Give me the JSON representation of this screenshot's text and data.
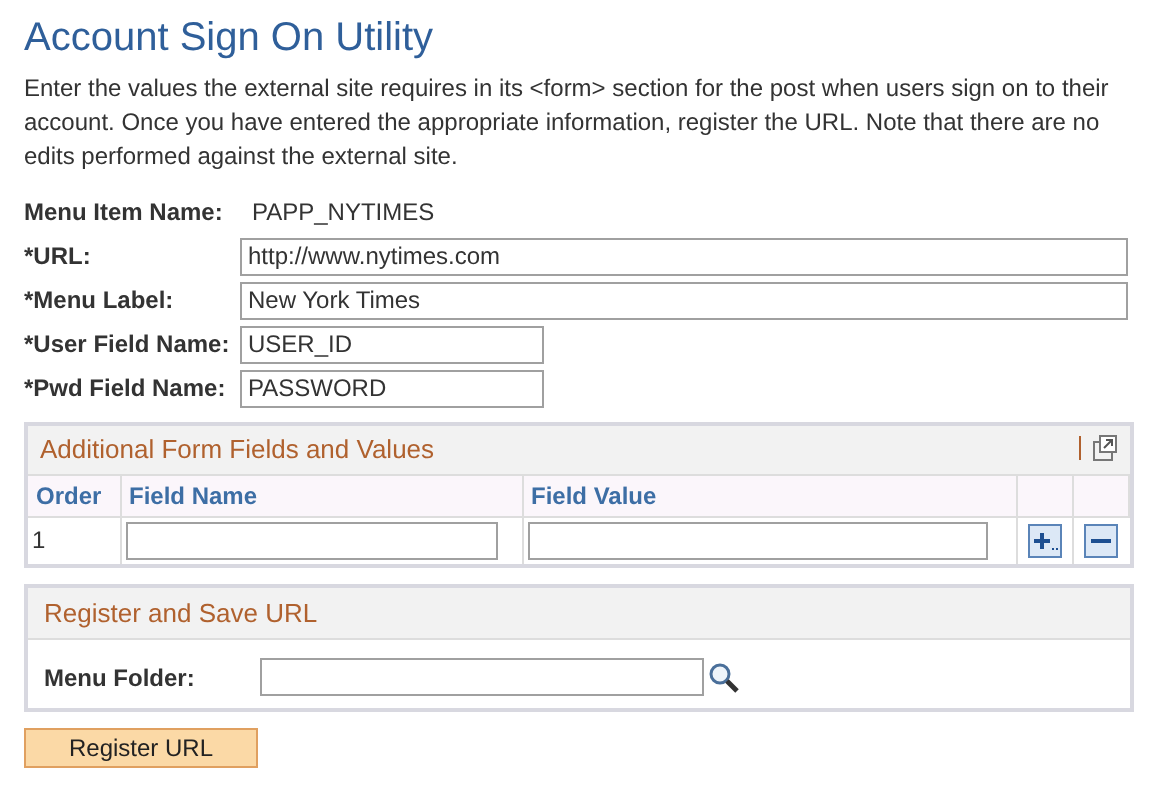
{
  "title": "Account Sign On Utility",
  "description": "Enter the values the external site requires in its <form> section for the post when users sign on to their account. Once you have entered the appropriate information, register the URL. Note that there are no edits performed against the external site.",
  "fields": [
    {
      "label": "Menu Item Name:",
      "value": "PAPP_NYTIMES",
      "kind": "static"
    },
    {
      "label": "*URL:",
      "value": "http://www.nytimes.com",
      "kind": "long"
    },
    {
      "label": "*Menu Label:",
      "value": "New York Times",
      "kind": "long"
    },
    {
      "label": "*User Field Name:",
      "value": "USER_ID",
      "kind": "short"
    },
    {
      "label": "*Pwd Field Name:",
      "value": "PASSWORD",
      "kind": "short"
    }
  ],
  "grid": {
    "title": "Additional Form Fields and Values",
    "columns": [
      "Order",
      "Field Name",
      "Field Value"
    ],
    "rows": [
      {
        "order": "1"
      }
    ]
  },
  "register": {
    "title": "Register and Save URL",
    "folder_label": "Menu Folder:"
  },
  "button": "Register URL"
}
